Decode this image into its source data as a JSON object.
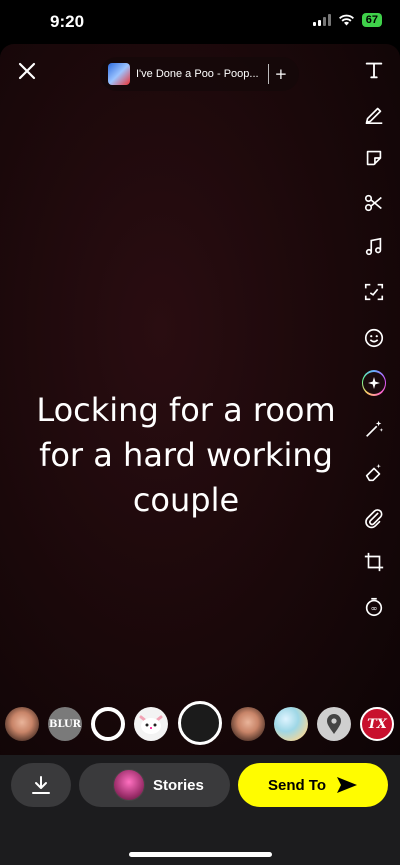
{
  "status_bar": {
    "time": "9:20",
    "battery": "67"
  },
  "song": {
    "title": "I've Done a Poo - Poop...",
    "add_label": "+"
  },
  "toolbar": {
    "items": [
      {
        "icon": "text-icon"
      },
      {
        "icon": "pencil-icon"
      },
      {
        "icon": "sticker-icon"
      },
      {
        "icon": "scissors-icon"
      },
      {
        "icon": "music-icon"
      },
      {
        "icon": "lens-scan-icon"
      },
      {
        "icon": "emoji-icon"
      },
      {
        "icon": "ai-sparkle-icon"
      },
      {
        "icon": "magic-wand-icon"
      },
      {
        "icon": "eraser-icon"
      },
      {
        "icon": "paperclip-icon"
      },
      {
        "icon": "crop-icon"
      },
      {
        "icon": "timer-icon"
      }
    ]
  },
  "caption": {
    "line1": "Locking for a room",
    "line2": "for a hard working",
    "line3": "couple"
  },
  "lenses": {
    "blur_label": "BLUR",
    "tx_label": "TX"
  },
  "bottom_bar": {
    "stories_label": "Stories",
    "send_label": "Send To"
  },
  "colors": {
    "send_button": "#fffc00",
    "battery": "#3fd14a"
  }
}
